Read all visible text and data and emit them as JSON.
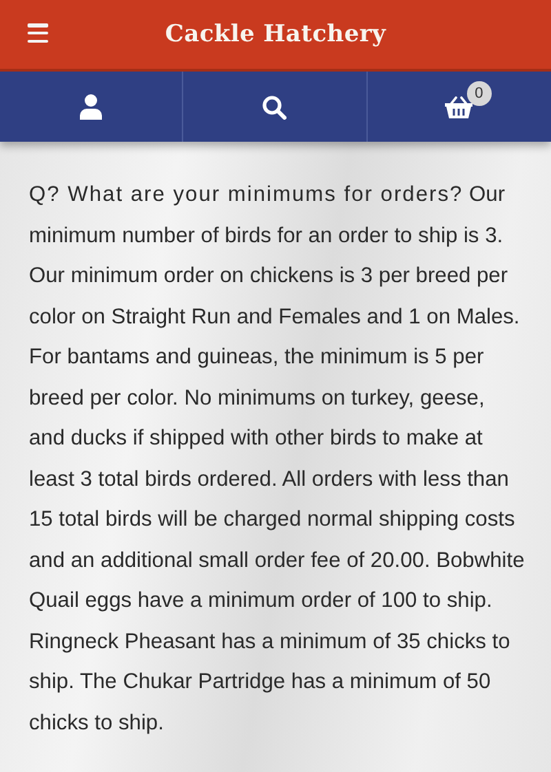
{
  "header": {
    "title": "Cackle Hatchery"
  },
  "nav": {
    "cart_count": "0"
  },
  "faq": {
    "question": "Q? What are your minimums for orders?",
    "answer": "Our minimum number of birds for an order to ship is 3.  Our minimum order on chickens is 3 per breed per color on Straight Run and Females and 1 on Males. For bantams and guineas, the minimum is 5 per breed per color. No minimums on turkey, geese, and ducks if shipped with other birds to make at least 3 total birds ordered. All orders with less than 15 total birds will be charged normal shipping costs and an additional small order fee of 20.00. Bobwhite Quail eggs have a minimum order of 100 to ship. Ringneck Pheasant has a minimum of 35 chicks to ship. The Chukar Partridge has a minimum of 50 chicks to ship."
  }
}
